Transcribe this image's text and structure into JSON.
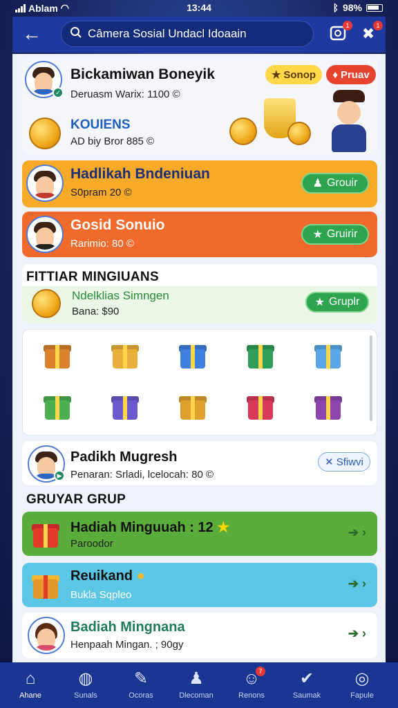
{
  "status": {
    "carrier": "Ablam",
    "time": "13:44",
    "battery": "98%"
  },
  "topbar": {
    "search_text": "Câmera Sosial Undacl Idoaain",
    "notif_count": "1",
    "reward_count": "1"
  },
  "profile": {
    "name": "Bickamiwan Boneyik",
    "subtitle": "Deruasm Warix: 1100 ©",
    "pill_shop": "Sonop",
    "pill_prize": "Pruav",
    "coins_title": "KOUIENS",
    "coins_sub": "AD biy Bror 885 ©"
  },
  "group_cards": [
    {
      "name": "Hadlikah Bndeniuan",
      "sub": "S0pram 20 ©",
      "btn": "Grouir",
      "btn_icon": "user-add-icon",
      "color": "#f5a623"
    },
    {
      "name": "Gosid Sonuio",
      "sub": "Rarimio: 80 ©",
      "btn": "Gruirir",
      "btn_icon": "star-icon",
      "color": "#f06a2a"
    }
  ],
  "weekly": {
    "title": "FITTIAR MINGIUANS",
    "item_name": "Ndelklias Simngen",
    "item_sub": "Bana: $90",
    "btn": "Gruplr"
  },
  "gift_grid": {
    "colors": [
      "#d9822b",
      "#e8b03a",
      "#3f7fe0",
      "#2f9e5a",
      "#5aa8e8",
      "#4caf50",
      "#6a5acd",
      "#e0a030",
      "#d83a5a",
      "#8e44ad"
    ]
  },
  "prize_row": {
    "name": "Padikh Mugresh",
    "sub": "Penaran: Srladi, lcelocah: 80 ©",
    "btn": "Sfiwvi"
  },
  "groups_section": {
    "title": "GRUYAR GRUP"
  },
  "list_cards": [
    {
      "name": "Hadiah Minguuah : 12",
      "sub": "Paroodor",
      "color": "#5aad3a"
    },
    {
      "name": "Reuikand",
      "sub": "Bukla Sqpleo",
      "color": "#5cc6e6"
    },
    {
      "name": "Badiah Mingnana",
      "sub": "Henpaah Mingan. ; 90gy",
      "color": "#ffffff"
    }
  ],
  "nav": [
    {
      "label": "Ahane",
      "icon": "home-icon"
    },
    {
      "label": "Sunals",
      "icon": "globe-icon"
    },
    {
      "label": "Ocoras",
      "icon": "edit-icon"
    },
    {
      "label": "Dlecoman",
      "icon": "person-icon"
    },
    {
      "label": "Renons",
      "icon": "chat-icon",
      "badge": "7"
    },
    {
      "label": "Saumak",
      "icon": "check-icon"
    },
    {
      "label": "Fapule",
      "icon": "profile-icon"
    }
  ]
}
